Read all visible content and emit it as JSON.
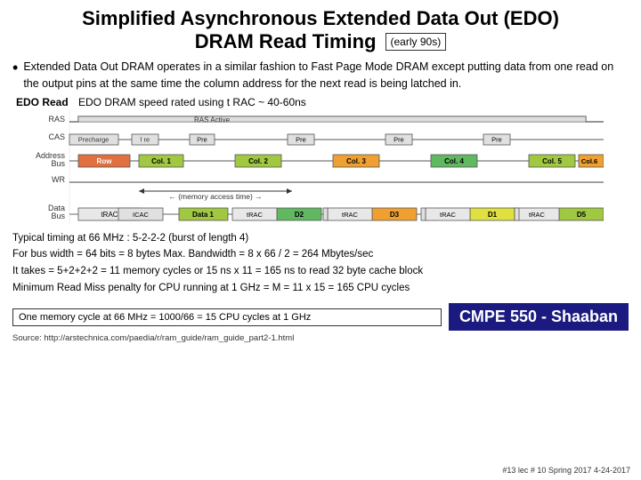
{
  "title": {
    "line1": "Simplified Asynchronous Extended Data Out (EDO)",
    "line2": "DRAM Read Timing",
    "badge": "(early 90s)"
  },
  "bullet": {
    "text": "Extended Data Out DRAM operates in a similar fashion  to Fast Page Mode DRAM  except putting data from one read  on the output pins at the same time the column address for the next read is being latched in."
  },
  "diagram": {
    "label": "EDO Read",
    "speed": "EDO DRAM speed rated using t RAC  ~  40-60ns"
  },
  "timing": {
    "line1": "Typical timing at  66 MHz  :   5-2-2-2      (burst of length 4)",
    "line2": "For bus width = 64 bits =  8 bytes      Max.  Bandwidth  =  8 x 66 / 2  =  264  Mbytes/sec",
    "line3": "It takes  =  5+2+2+2  =  11  memory cycles  or   15 ns  x 11 =  165  ns  to read 32 byte cache block",
    "line4": "Minimum  Read Miss penalty for  CPU  running at 1 GHz  =  M =  11 x 15  =  165   CPU cycles"
  },
  "bottom": {
    "one_cycle": "One memory cycle at 66 MHz  =  1000/66 = 15 CPU cycles at 1 GHz",
    "cmpe": "CMPE 550 - Shaaban"
  },
  "source": {
    "label": "Source:",
    "url": "http://arstechnica.com/paedia/r/ram_guide/ram_guide_part2-1.html"
  },
  "slide_num": "#13   lec # 10   Spring 2017   4-24-2017"
}
